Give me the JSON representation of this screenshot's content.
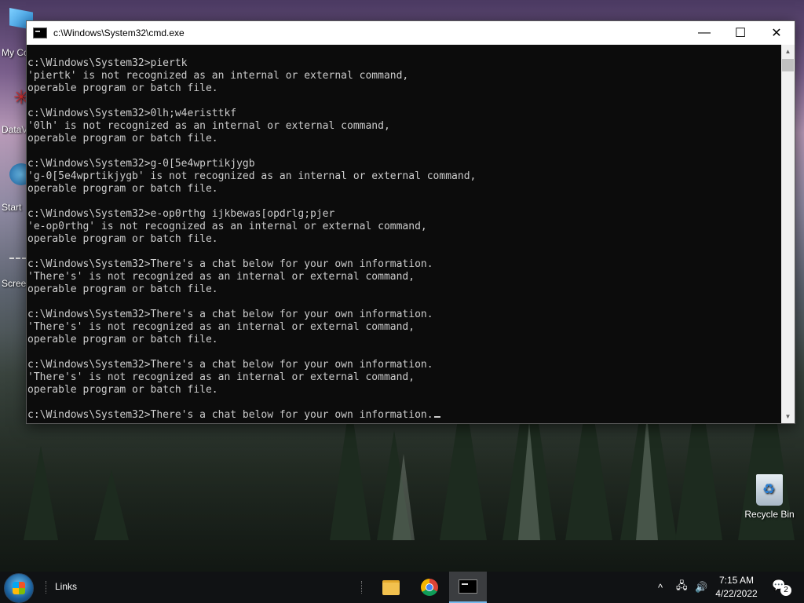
{
  "desktop": {
    "icons": [
      {
        "label": "My Co",
        "icon": "computer-icon"
      },
      {
        "label": "DataV",
        "icon": "datav-shortcut-icon"
      },
      {
        "label": "Start",
        "icon": "start-shortcut-icon"
      },
      {
        "label": "Scree",
        "icon": "screenshot-shortcut-icon"
      }
    ],
    "recycle_bin": {
      "label": "Recycle Bin",
      "icon": "recycle-bin-icon"
    }
  },
  "window": {
    "title": "c:\\Windows\\System32\\cmd.exe",
    "buttons": {
      "minimize": "—",
      "maximize": "☐",
      "close": "✕"
    },
    "console_lines": [
      "c:\\Windows\\System32>piertk",
      "'piertk' is not recognized as an internal or external command,",
      "operable program or batch file.",
      "",
      "c:\\Windows\\System32>0lh;w4eristtkf",
      "'0lh' is not recognized as an internal or external command,",
      "operable program or batch file.",
      "",
      "c:\\Windows\\System32>g-0[5e4wprtikjygb",
      "'g-0[5e4wprtikjygb' is not recognized as an internal or external command,",
      "operable program or batch file.",
      "",
      "c:\\Windows\\System32>e-op0rthg ijkbewas[opdrlg;pjer",
      "'e-op0rthg' is not recognized as an internal or external command,",
      "operable program or batch file.",
      "",
      "c:\\Windows\\System32>There's a chat below for your own information.",
      "'There's' is not recognized as an internal or external command,",
      "operable program or batch file.",
      "",
      "c:\\Windows\\System32>There's a chat below for your own information.",
      "'There's' is not recognized as an internal or external command,",
      "operable program or batch file.",
      "",
      "c:\\Windows\\System32>There's a chat below for your own information.",
      "'There's' is not recognized as an internal or external command,",
      "operable program or batch file.",
      ""
    ],
    "current_input": "c:\\Windows\\System32>There's a chat below for your own information."
  },
  "taskbar": {
    "links_label": "Links",
    "apps": [
      {
        "name": "File Explorer",
        "icon": "folder-icon"
      },
      {
        "name": "Google Chrome",
        "icon": "chrome-icon"
      },
      {
        "name": "Command Prompt",
        "icon": "cmd-icon",
        "active": true
      }
    ],
    "tray": {
      "chevron": "^",
      "network": "🖧",
      "volume": "🔊"
    },
    "clock": {
      "time": "7:15 AM",
      "date": "4/22/2022"
    },
    "notifications": {
      "icon": "💬",
      "count": "2"
    }
  }
}
